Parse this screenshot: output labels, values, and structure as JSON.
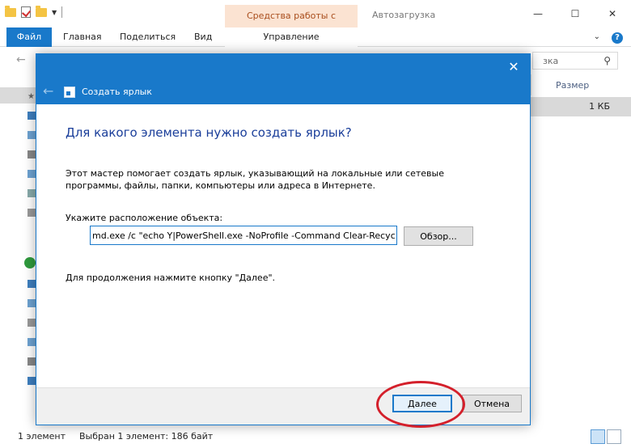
{
  "explorer": {
    "context_tab_group": "Средства работы с ярлыками",
    "window_title": "Автозагрузка",
    "controls": {
      "minimize": "—",
      "maximize": "☐",
      "close": "✕"
    },
    "ribbon_tabs": {
      "file": "Файл",
      "home": "Главная",
      "share": "Поделиться",
      "view": "Вид",
      "manage": "Управление"
    },
    "search_placeholder": "зка",
    "column_size": "Размер",
    "file_size": "1 КБ",
    "status_count": "1 элемент",
    "status_selected": "Выбран 1 элемент: 186 байт"
  },
  "dialog": {
    "title": "Создать ярлык",
    "close_glyph": "✕",
    "back_glyph": "←",
    "heading": "Для какого элемента нужно создать ярлык?",
    "description": "Этот мастер помогает создать ярлык, указывающий на локальные или сетевые программы, файлы, папки, компьютеры или адреса в Интернете.",
    "location_label": "Укажите расположение объекта:",
    "location_value": "md.exe /c \"echo Y|PowerShell.exe -NoProfile -Command Clear-RecycleBin\"",
    "browse_label": "Обзор...",
    "hint": "Для продолжения нажмите кнопку \"Далее\".",
    "next_label": "Далее",
    "cancel_label": "Отмена"
  },
  "colors": {
    "accent": "#1979ca",
    "context_tab": "#fbe3d2",
    "highlight": "#d4202b"
  }
}
